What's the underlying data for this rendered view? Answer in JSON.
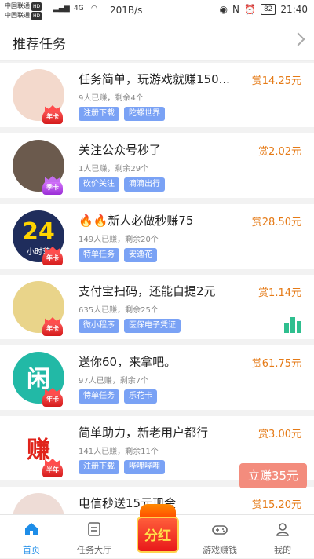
{
  "statusbar": {
    "carrier1": "中国联通",
    "carrier2": "中国联通",
    "hd": "HD",
    "network": "4G",
    "speed": "201B/s",
    "battery": "82",
    "time": "21:40"
  },
  "header": {
    "title": "推荐任务"
  },
  "tasks": [
    {
      "title": "任务简单，玩游戏就赚150...",
      "meta": "9人已赚，剩余4个",
      "reward": "赏14.25元",
      "tags": [
        "注册下载",
        "陀螺世界"
      ],
      "badge": "年卡",
      "badge_type": "year",
      "avatar_color": "#f3d9cc"
    },
    {
      "title": "关注公众号秒了",
      "meta": "1人已赚，剩余29个",
      "reward": "赏2.02元",
      "tags": [
        "砍价关注",
        "滴滴出行"
      ],
      "badge": "季卡",
      "badge_type": "season",
      "avatar_color": "#6b5a4d"
    },
    {
      "title": "🔥🔥新人必做秒赚75",
      "meta": "149人已赚，剩余20个",
      "reward": "赏28.50元",
      "tags": [
        "特单任务",
        "安逸花"
      ],
      "badge": "年卡",
      "badge_type": "year",
      "avatar_color": "#1f2d5c",
      "avatar_text": "24",
      "avatar_sub": "小时营"
    },
    {
      "title": "支付宝扫码，还能自提2元",
      "meta": "635人已赚，剩余25个",
      "reward": "赏1.14元",
      "tags": [
        "微小程序",
        "医保电子凭证"
      ],
      "badge": "年卡",
      "badge_type": "year",
      "avatar_color": "#e9d48a"
    },
    {
      "title": "送你60，来拿吧。",
      "meta": "97人已赚，剩余7个",
      "reward": "赏61.75元",
      "tags": [
        "特单任务",
        "乐花卡"
      ],
      "badge": "年卡",
      "badge_type": "year",
      "avatar_color": "#22b9a6",
      "avatar_text": "闲"
    },
    {
      "title": "简单助力，新老用户都行",
      "meta": "141人已赚，剩余11个",
      "reward": "赏3.00元",
      "tags": [
        "注册下载",
        "哔哩哔哩"
      ],
      "badge": "半年",
      "badge_type": "year",
      "avatar_color": "#ffffff",
      "avatar_text": "赚"
    },
    {
      "title": "电信秒送15元现金",
      "meta": "",
      "reward": "赏15.20元",
      "tags": [],
      "badge": "",
      "badge_type": "year",
      "avatar_color": "#eedcd6"
    }
  ],
  "float_button": "立赚35元",
  "center_button": "分红",
  "tabs": [
    {
      "label": "首页",
      "icon": "home-icon",
      "active": true
    },
    {
      "label": "任务大厅",
      "icon": "list-icon",
      "active": false
    },
    {
      "label": "游戏赚钱",
      "icon": "gamepad-icon",
      "active": false
    },
    {
      "label": "我的",
      "icon": "user-icon",
      "active": false
    }
  ],
  "colors": {
    "accent": "#1e8de8",
    "reward": "#e57a16",
    "tag": "#7aa2f5",
    "float": "#f38c7d"
  }
}
